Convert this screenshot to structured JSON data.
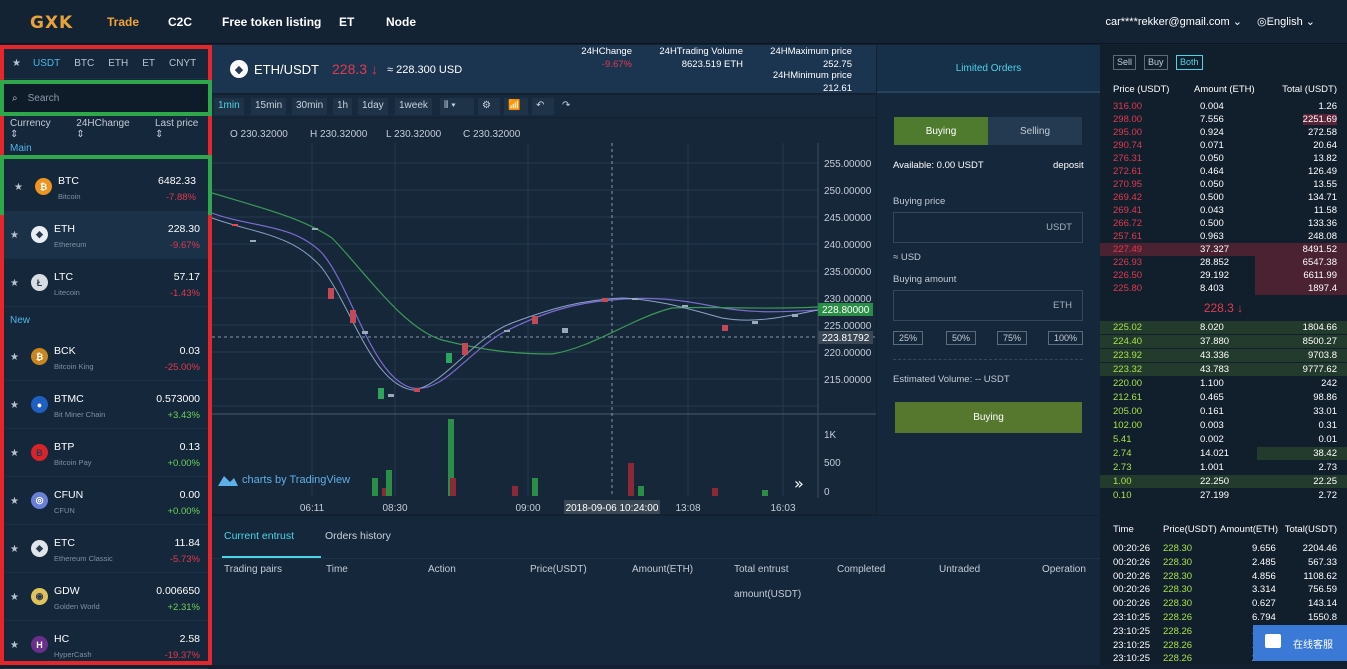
{
  "nav": {
    "logo": "GXK",
    "items": [
      "Trade",
      "C2C",
      "Free token listing",
      "ET",
      "Node"
    ],
    "user": "car****rekker@gmail.com",
    "lang": "English"
  },
  "left": {
    "tabs": [
      "USDT",
      "BTC",
      "ETH",
      "ET",
      "CNYT"
    ],
    "search_placeholder": "Search",
    "sort": [
      "Currency",
      "24HChange",
      "Last price"
    ],
    "section_main": "Main",
    "section_new": "New",
    "main_coins": [
      {
        "sym": "BTC",
        "name": "Bitcoin",
        "price": "6482.33",
        "change": "-7.88%",
        "dir": "neg",
        "color": "#f09421",
        "glyph": "₿"
      },
      {
        "sym": "ETH",
        "name": "Ethereum",
        "price": "228.30",
        "change": "-9.67%",
        "dir": "neg",
        "color": "#e9eef5",
        "glyph": "◆"
      },
      {
        "sym": "LTC",
        "name": "Litecoin",
        "price": "57.17",
        "change": "-1.43%",
        "dir": "neg",
        "color": "#d8dde3",
        "glyph": "Ł"
      }
    ],
    "new_coins": [
      {
        "sym": "BCK",
        "name": "Bitcoin King",
        "price": "0.03",
        "change": "-25.00%",
        "dir": "neg",
        "color": "#c9861d",
        "glyph": "₿"
      },
      {
        "sym": "BTMC",
        "name": "Bit Miner Chain",
        "price": "0.573000",
        "change": "+3.43%",
        "dir": "pos",
        "color": "#1f5fc2",
        "glyph": "●"
      },
      {
        "sym": "BTP",
        "name": "Bitcoin Pay",
        "price": "0.13",
        "change": "+0.00%",
        "dir": "pos",
        "color": "#d8232a",
        "glyph": "B"
      },
      {
        "sym": "CFUN",
        "name": "CFUN",
        "price": "0.00",
        "change": "+0.00%",
        "dir": "pos",
        "color": "#6a7fd8",
        "glyph": "◎"
      },
      {
        "sym": "ETC",
        "name": "Ethereum Classic",
        "price": "11.84",
        "change": "-5.73%",
        "dir": "neg",
        "color": "#dfe5ea",
        "glyph": "◆"
      },
      {
        "sym": "GDW",
        "name": "Golden World",
        "price": "0.006650",
        "change": "+2.31%",
        "dir": "pos",
        "color": "#e0c35a",
        "glyph": "◉"
      },
      {
        "sym": "HC",
        "name": "HyperCash",
        "price": "2.58",
        "change": "-19.37%",
        "dir": "neg",
        "color": "#6a2f8a",
        "glyph": "H"
      }
    ]
  },
  "header": {
    "pair": "ETH/USDT",
    "price": "228.3 ↓",
    "usd": "≈ 228.300 USD",
    "change_label": "24HChange",
    "change_value": "-9.67%",
    "volume_label": "24HTrading Volume",
    "volume_value": "8623.519 ETH",
    "max_label": "24HMaximum price",
    "max_value": "252.75",
    "min_label": "24HMinimum price",
    "min_value": "212.61"
  },
  "toolbar": {
    "intervals": [
      "1min",
      "15min",
      "30min",
      "1h",
      "1day",
      "1week"
    ]
  },
  "chart": {
    "ohlc": {
      "o": "O 230.32000",
      "h": "H 230.32000",
      "l": "L 230.32000",
      "c": "C 230.32000"
    },
    "y_ticks": [
      "255.00000",
      "250.00000",
      "245.00000",
      "240.00000",
      "235.00000",
      "230.00000",
      "225.00000",
      "220.00000",
      "215.00000"
    ],
    "current_tag": "228.80000",
    "cross_tag": "223.81792",
    "vol_ticks": [
      "1K",
      "500",
      "0"
    ],
    "x_ticks": [
      "06:11",
      "08:30",
      "09:00",
      "13:08",
      "16:03"
    ],
    "cross_time": "2018-09-06 10:24:00",
    "watermark": "charts by TradingView"
  },
  "bottom": {
    "tabs": [
      "Current entrust",
      "Orders history"
    ],
    "columns": [
      "Trading pairs",
      "Time",
      "Action",
      "Price(USDT)",
      "Amount(ETH)",
      "Total entrust",
      "Completed",
      "Untraded",
      "Operation"
    ],
    "total_sub": "amount(USDT)"
  },
  "form": {
    "title": "Limited Orders",
    "buy": "Buying",
    "sell": "Selling",
    "available": "Available:  0.00 USDT",
    "deposit": "deposit",
    "price_label": "Buying price",
    "price_unit": "USDT",
    "approx": "≈ USD",
    "amount_label": "Buying amount",
    "amount_unit": "ETH",
    "pcts": [
      "25%",
      "50%",
      "75%",
      "100%"
    ],
    "est": "Estimated Volume:  -- USDT",
    "submit": "Buying"
  },
  "book": {
    "buttons": [
      "Sell",
      "Buy",
      "Both"
    ],
    "headers": [
      "Price (USDT)",
      "Amount (ETH)",
      "Total (USDT)"
    ],
    "asks": [
      [
        "316.00",
        "0.004",
        "1.26"
      ],
      [
        "298.00",
        "7.556",
        "2251.69"
      ],
      [
        "295.00",
        "0.924",
        "272.58"
      ],
      [
        "290.74",
        "0.071",
        "20.64"
      ],
      [
        "276.31",
        "0.050",
        "13.82"
      ],
      [
        "272.61",
        "0.464",
        "126.49"
      ],
      [
        "270.95",
        "0.050",
        "13.55"
      ],
      [
        "269.42",
        "0.500",
        "134.71"
      ],
      [
        "269.41",
        "0.043",
        "11.58"
      ],
      [
        "266.72",
        "0.500",
        "133.36"
      ],
      [
        "257.61",
        "0.963",
        "248.08"
      ],
      [
        "227.49",
        "37.327",
        "8491.52"
      ],
      [
        "226.93",
        "28.852",
        "6547.38"
      ],
      [
        "226.50",
        "29.192",
        "6611.99"
      ],
      [
        "225.80",
        "8.403",
        "1897.4"
      ]
    ],
    "last": "228.3 ↓",
    "bids": [
      [
        "225.02",
        "8.020",
        "1804.66"
      ],
      [
        "224.40",
        "37.880",
        "8500.27"
      ],
      [
        "223.92",
        "43.336",
        "9703.8"
      ],
      [
        "223.32",
        "43.783",
        "9777.62"
      ],
      [
        "220.00",
        "1.100",
        "242"
      ],
      [
        "212.61",
        "0.465",
        "98.86"
      ],
      [
        "205.00",
        "0.161",
        "33.01"
      ],
      [
        "102.00",
        "0.003",
        "0.31"
      ],
      [
        "5.41",
        "0.002",
        "0.01"
      ],
      [
        "2.74",
        "14.021",
        "38.42"
      ],
      [
        "2.73",
        "1.001",
        "2.73"
      ],
      [
        "1.00",
        "22.250",
        "22.25"
      ],
      [
        "0.10",
        "27.199",
        "2.72"
      ]
    ]
  },
  "trades": {
    "headers": [
      "Time",
      "Price(USDT)",
      "Amount(ETH)",
      "Total(USDT)"
    ],
    "rows": [
      [
        "00:20:26",
        "228.30",
        "9.656",
        "2204.46"
      ],
      [
        "00:20:26",
        "228.30",
        "2.485",
        "567.33"
      ],
      [
        "00:20:26",
        "228.30",
        "4.856",
        "1108.62"
      ],
      [
        "00:20:26",
        "228.30",
        "3.314",
        "756.59"
      ],
      [
        "00:20:26",
        "228.30",
        "0.627",
        "143.14"
      ],
      [
        "23:10:25",
        "228.26",
        "6.794",
        "1550.8"
      ],
      [
        "23:10:25",
        "228.26",
        "1.77",
        ""
      ],
      [
        "23:10:25",
        "228.26",
        "1.26",
        ""
      ],
      [
        "23:10:25",
        "228.26",
        "2.33",
        ""
      ]
    ]
  },
  "chat": "在线客服"
}
